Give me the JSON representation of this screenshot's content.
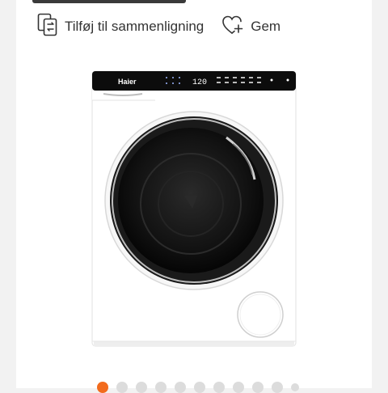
{
  "actions": {
    "compare_label": "Tilføj til sammenligning",
    "save_label": "Gem"
  },
  "product": {
    "brand": "Haier",
    "display_value": "120",
    "compare_icon": "compare-icon",
    "save_icon": "heart-plus-icon"
  },
  "carousel": {
    "total": 11,
    "active_index": 0
  },
  "colors": {
    "accent": "#f26b1d",
    "inactive_dot": "#dcdcdc"
  }
}
